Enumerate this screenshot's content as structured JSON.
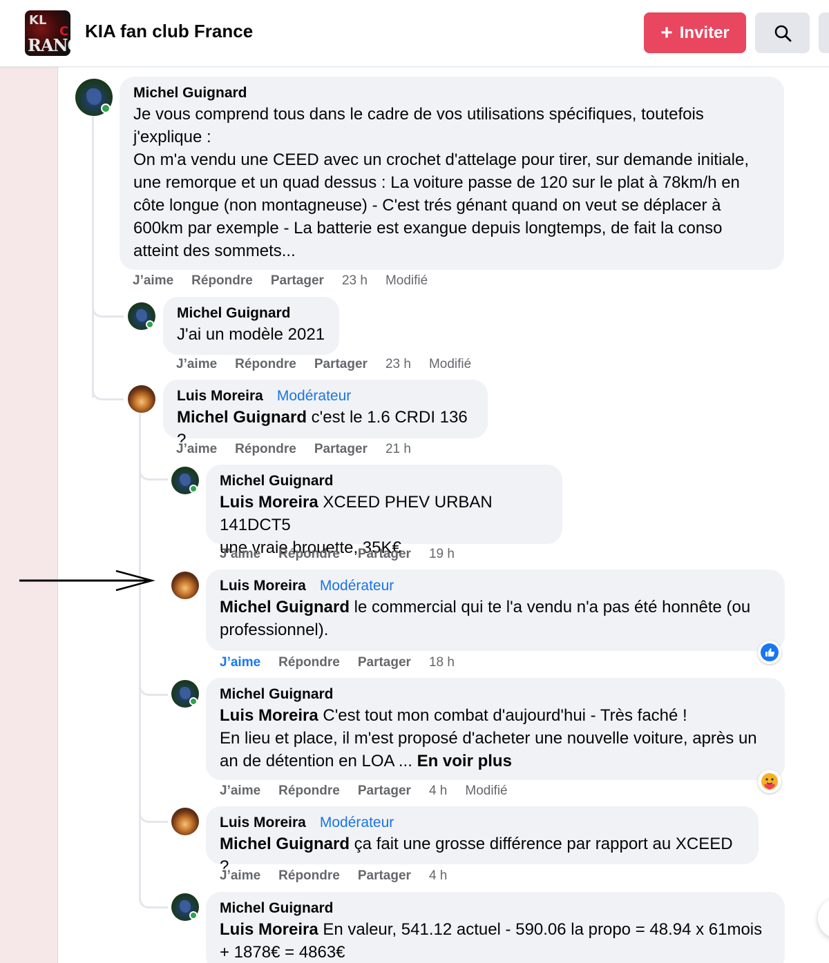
{
  "header": {
    "group_name": "KIA fan club France",
    "logo_text_top": "KL",
    "logo_text_mid": "C",
    "logo_text_bottom": "RANC",
    "invite_label": "Inviter",
    "search_icon": "search-icon"
  },
  "comments": [
    {
      "author": "Michel Guignard",
      "role": "",
      "mention": "",
      "text_lines": [
        "Je vous comprend tous dans le cadre de vos utilisations spécifiques, toutefois",
        "j'explique :",
        "On m'a vendu une CEED avec un crochet d'attelage pour tirer, sur demande initiale,",
        "une remorque et un quad dessus : La voiture passe de 120 sur le plat à 78km/h en",
        "côte longue (non montagneuse) - C'est trés génant quand on veut se déplacer à",
        "600km par exemple - La batterie est exangue depuis longtemps, de fait la conso",
        "atteint des sommets..."
      ],
      "actions": {
        "like": "J’aime",
        "reply": "Répondre",
        "share": "Partager",
        "time": "23 h",
        "edited": "Modifié"
      }
    },
    {
      "author": "Michel Guignard",
      "role": "",
      "text": "J'ai un modèle 2021",
      "actions": {
        "like": "J’aime",
        "reply": "Répondre",
        "share": "Partager",
        "time": "23 h",
        "edited": "Modifié"
      }
    },
    {
      "author": "Luis Moreira",
      "role": "Modérateur",
      "mention": "Michel Guignard",
      "text": " c'est le 1.6 CRDI 136 ?",
      "actions": {
        "like": "J’aime",
        "reply": "Répondre",
        "share": "Partager",
        "time": "21 h"
      }
    },
    {
      "author": "Michel Guignard",
      "role": "",
      "mention": "Luis Moreira",
      "text": " XCEED PHEV URBAN 141DCT5",
      "text2": "une vraie brouette, 35K€",
      "actions": {
        "like": "J’aime",
        "reply": "Répondre",
        "share": "Partager",
        "time": "19 h"
      }
    },
    {
      "author": "Luis Moreira",
      "role": "Modérateur",
      "mention": "Michel Guignard",
      "text": " le commercial qui te l'a vendu n'a pas été honnête (ou",
      "text2": "professionnel).",
      "actions": {
        "like": "J’aime",
        "reply": "Répondre",
        "share": "Partager",
        "time": "18 h"
      },
      "reaction": "like-reaction-icon"
    },
    {
      "author": "Michel Guignard",
      "role": "",
      "mention": "Luis Moreira",
      "text": " C'est tout mon combat d'aujourd'hui - Très faché !",
      "text2": "En lieu et place, il m'est proposé d'acheter une nouvelle voiture, après un",
      "text3": "an de détention en LOA ... ",
      "see_more": "En voir plus",
      "actions": {
        "like": "J’aime",
        "reply": "Répondre",
        "share": "Partager",
        "time": "4 h",
        "edited": "Modifié"
      },
      "reaction": "care-reaction-icon"
    },
    {
      "author": "Luis Moreira",
      "role": "Modérateur",
      "mention": "Michel Guignard",
      "text": " ça fait une grosse différence par rapport au XCEED ?",
      "actions": {
        "like": "J’aime",
        "reply": "Répondre",
        "share": "Partager",
        "time": "4 h"
      }
    },
    {
      "author": "Michel Guignard",
      "role": "",
      "mention": "Luis Moreira",
      "text": " En valeur, 541.12 actuel - 590.06 la propo = 48.94 x 61mois",
      "text2": "+ 1878€ = 4863€"
    }
  ],
  "colors": {
    "brand_pink": "#e8475f",
    "moderator_blue": "#1b74e4",
    "liked_blue": "#1877f2",
    "online_green": "#31a24c",
    "bubble_bg": "#f0f2f5"
  }
}
